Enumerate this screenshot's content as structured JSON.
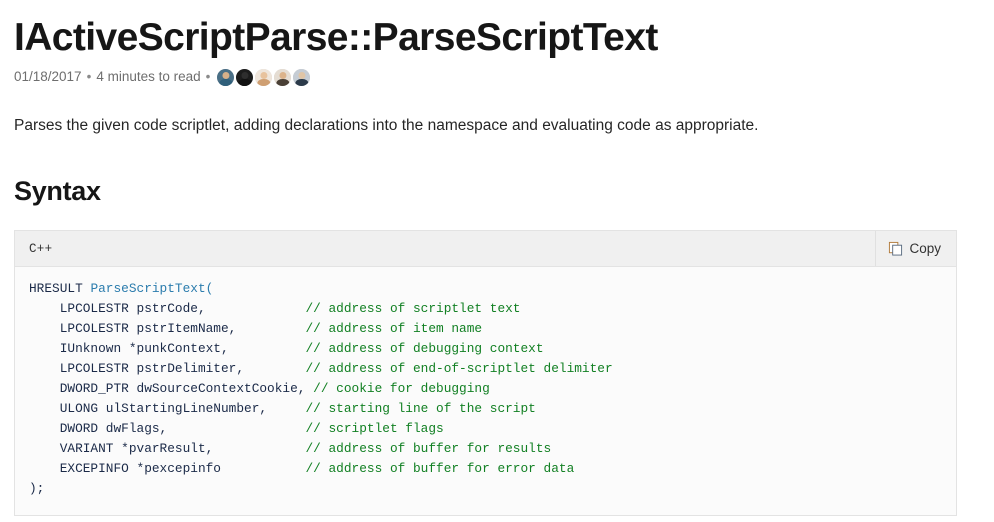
{
  "article": {
    "title": "IActiveScriptParse::ParseScriptText",
    "meta": {
      "date": "01/18/2017",
      "separator": "•",
      "read_time": "4 minutes to read",
      "contributors": [
        {
          "name": "contributor-1",
          "bg": "#4a6f86",
          "head": "#d8b089",
          "body": "#2f5f7a"
        },
        {
          "name": "contributor-2",
          "bg": "#1c1c1c",
          "head": "#2e2e2e",
          "body": "#111111"
        },
        {
          "name": "contributor-3",
          "bg": "#efe6dc",
          "head": "#e8c39e",
          "body": "#cf9f72"
        },
        {
          "name": "contributor-4",
          "bg": "#e5ddd3",
          "head": "#dcb38b",
          "body": "#4a4036"
        },
        {
          "name": "contributor-5",
          "bg": "#c5ccd4",
          "head": "#e0c5a6",
          "body": "#2b3a4a"
        }
      ]
    },
    "description": "Parses the given code scriptlet, adding declarations into the namespace and evaluating code as appropriate.",
    "section_heading": "Syntax"
  },
  "code_block": {
    "language": "C++",
    "copy_label": "Copy",
    "copy_icon": "copy-icon",
    "lines": [
      {
        "code": "HRESULT ",
        "fn": "ParseScriptText(",
        "comment": ""
      },
      {
        "code": "    LPCOLESTR pstrCode,             ",
        "fn": "",
        "comment": "// address of scriptlet text"
      },
      {
        "code": "    LPCOLESTR pstrItemName,         ",
        "fn": "",
        "comment": "// address of item name"
      },
      {
        "code": "    IUnknown *punkContext,          ",
        "fn": "",
        "comment": "// address of debugging context"
      },
      {
        "code": "    LPCOLESTR pstrDelimiter,        ",
        "fn": "",
        "comment": "// address of end-of-scriptlet delimiter"
      },
      {
        "code": "    DWORD_PTR dwSourceContextCookie, ",
        "fn": "",
        "comment": "// cookie for debugging"
      },
      {
        "code": "    ULONG ulStartingLineNumber,     ",
        "fn": "",
        "comment": "// starting line of the script"
      },
      {
        "code": "    DWORD dwFlags,                  ",
        "fn": "",
        "comment": "// scriptlet flags"
      },
      {
        "code": "    VARIANT *pvarResult,            ",
        "fn": "",
        "comment": "// address of buffer for results"
      },
      {
        "code": "    EXCEPINFO *pexcepinfo           ",
        "fn": "",
        "comment": "// address of buffer for error data"
      },
      {
        "code": ");",
        "fn": "",
        "comment": ""
      }
    ]
  },
  "colors": {
    "code_text": "#1b2a48",
    "code_function": "#2b7cad",
    "code_comment": "#128023",
    "header_bg": "#f0f0f0",
    "block_bg": "#fbfbfb",
    "border": "#e3e3e3",
    "meta_text": "#6e6e6e"
  }
}
